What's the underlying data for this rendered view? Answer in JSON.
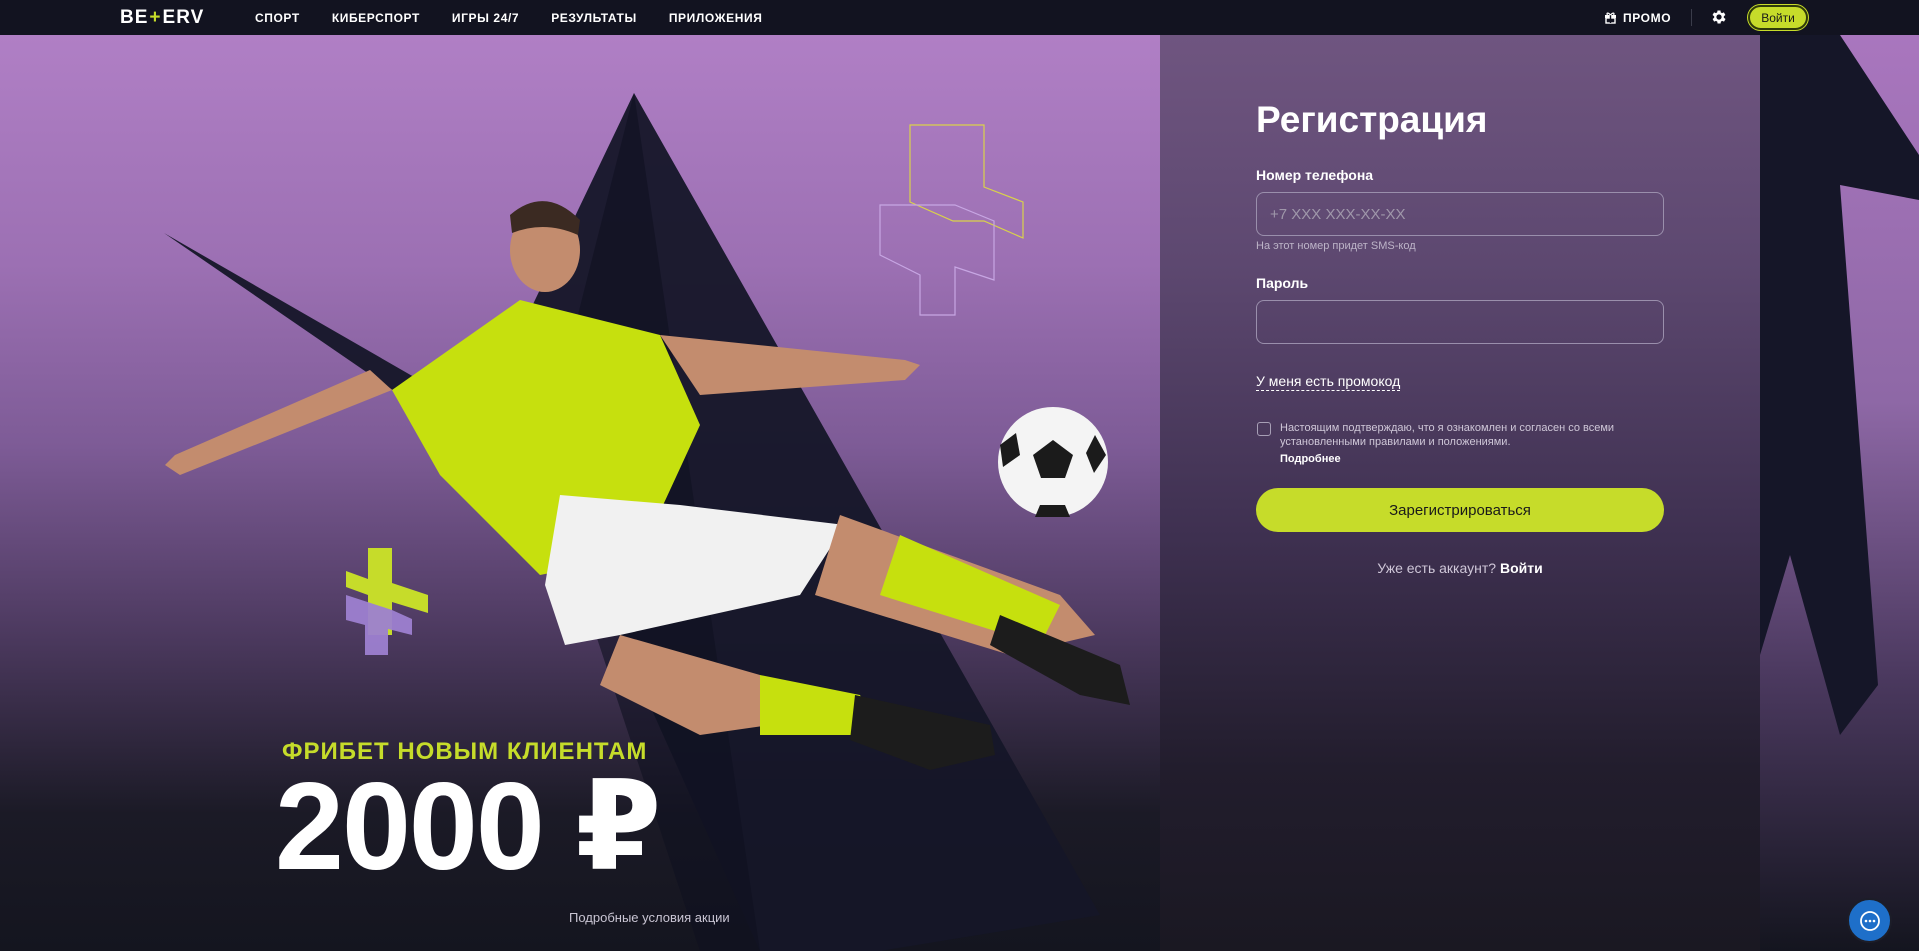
{
  "brand": {
    "logo_left": "BE",
    "logo_plus": "+",
    "logo_right": "ERV"
  },
  "nav": {
    "items": [
      {
        "label": "СПОРТ"
      },
      {
        "label": "КИБЕРСПОРТ"
      },
      {
        "label": "ИГРЫ 24/7"
      },
      {
        "label": "РЕЗУЛЬТАТЫ"
      },
      {
        "label": "ПРИЛОЖЕНИЯ"
      }
    ],
    "promo_label": "ПРОМО",
    "login_label": "Войти"
  },
  "hero": {
    "offer_title": "ФРИБЕТ НОВЫМ КЛИЕНТАМ",
    "offer_amount": "2000 ₽",
    "terms_link": "Подробные условия акции"
  },
  "registration": {
    "title": "Регистрация",
    "phone_label": "Номер телефона",
    "phone_placeholder": "+7 XXX XXX-XX-XX",
    "phone_value": "",
    "phone_hint": "На этот номер придет SMS-код",
    "password_label": "Пароль",
    "password_value": "",
    "promo_link": "У меня есть промокод",
    "agree_checked": false,
    "agree_text": "Настоящим подтверждаю, что я ознакомлен и согласен со всеми установленными правилами и положениями.",
    "more_link": "Подробнее",
    "submit_label": "Зарегистрироваться",
    "have_account": "Уже есть аккаунт?",
    "login_link": "Войти"
  },
  "colors": {
    "accent": "#c6dc2a",
    "nav_bg": "#121320",
    "chat": "#1e6fc9"
  },
  "icons": {
    "promo": "gift-icon",
    "settings": "gear-icon",
    "chat": "chat-icon"
  }
}
